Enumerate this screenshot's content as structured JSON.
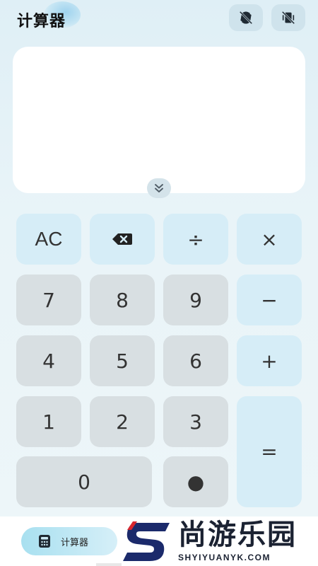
{
  "header": {
    "title": "计算器",
    "buttons": [
      {
        "icon": "no-rotate-icon"
      },
      {
        "icon": "vibrate-off-icon"
      }
    ]
  },
  "display": {
    "expression": "",
    "collapse_icon": "chevron-double-down-icon"
  },
  "keypad": {
    "ac": "AC",
    "backspace_icon": "backspace-icon",
    "divide": "÷",
    "multiply": "×",
    "seven": "7",
    "eight": "8",
    "nine": "9",
    "minus": "−",
    "four": "4",
    "five": "5",
    "six": "6",
    "plus": "+",
    "one": "1",
    "two": "2",
    "three": "3",
    "equals": "=",
    "zero": "0",
    "dot": "●"
  },
  "bottom_bar": {
    "calc_label": "计算器",
    "calc_icon": "calculator-icon"
  },
  "watermark": {
    "cn": "尚游乐园",
    "en": "SHYIYUANYK.COM"
  },
  "colors": {
    "key_gray": "#d8dfe2",
    "key_blue": "#d6edf7",
    "display_bg": "#ffffff",
    "accent": "#a8e0f0"
  }
}
